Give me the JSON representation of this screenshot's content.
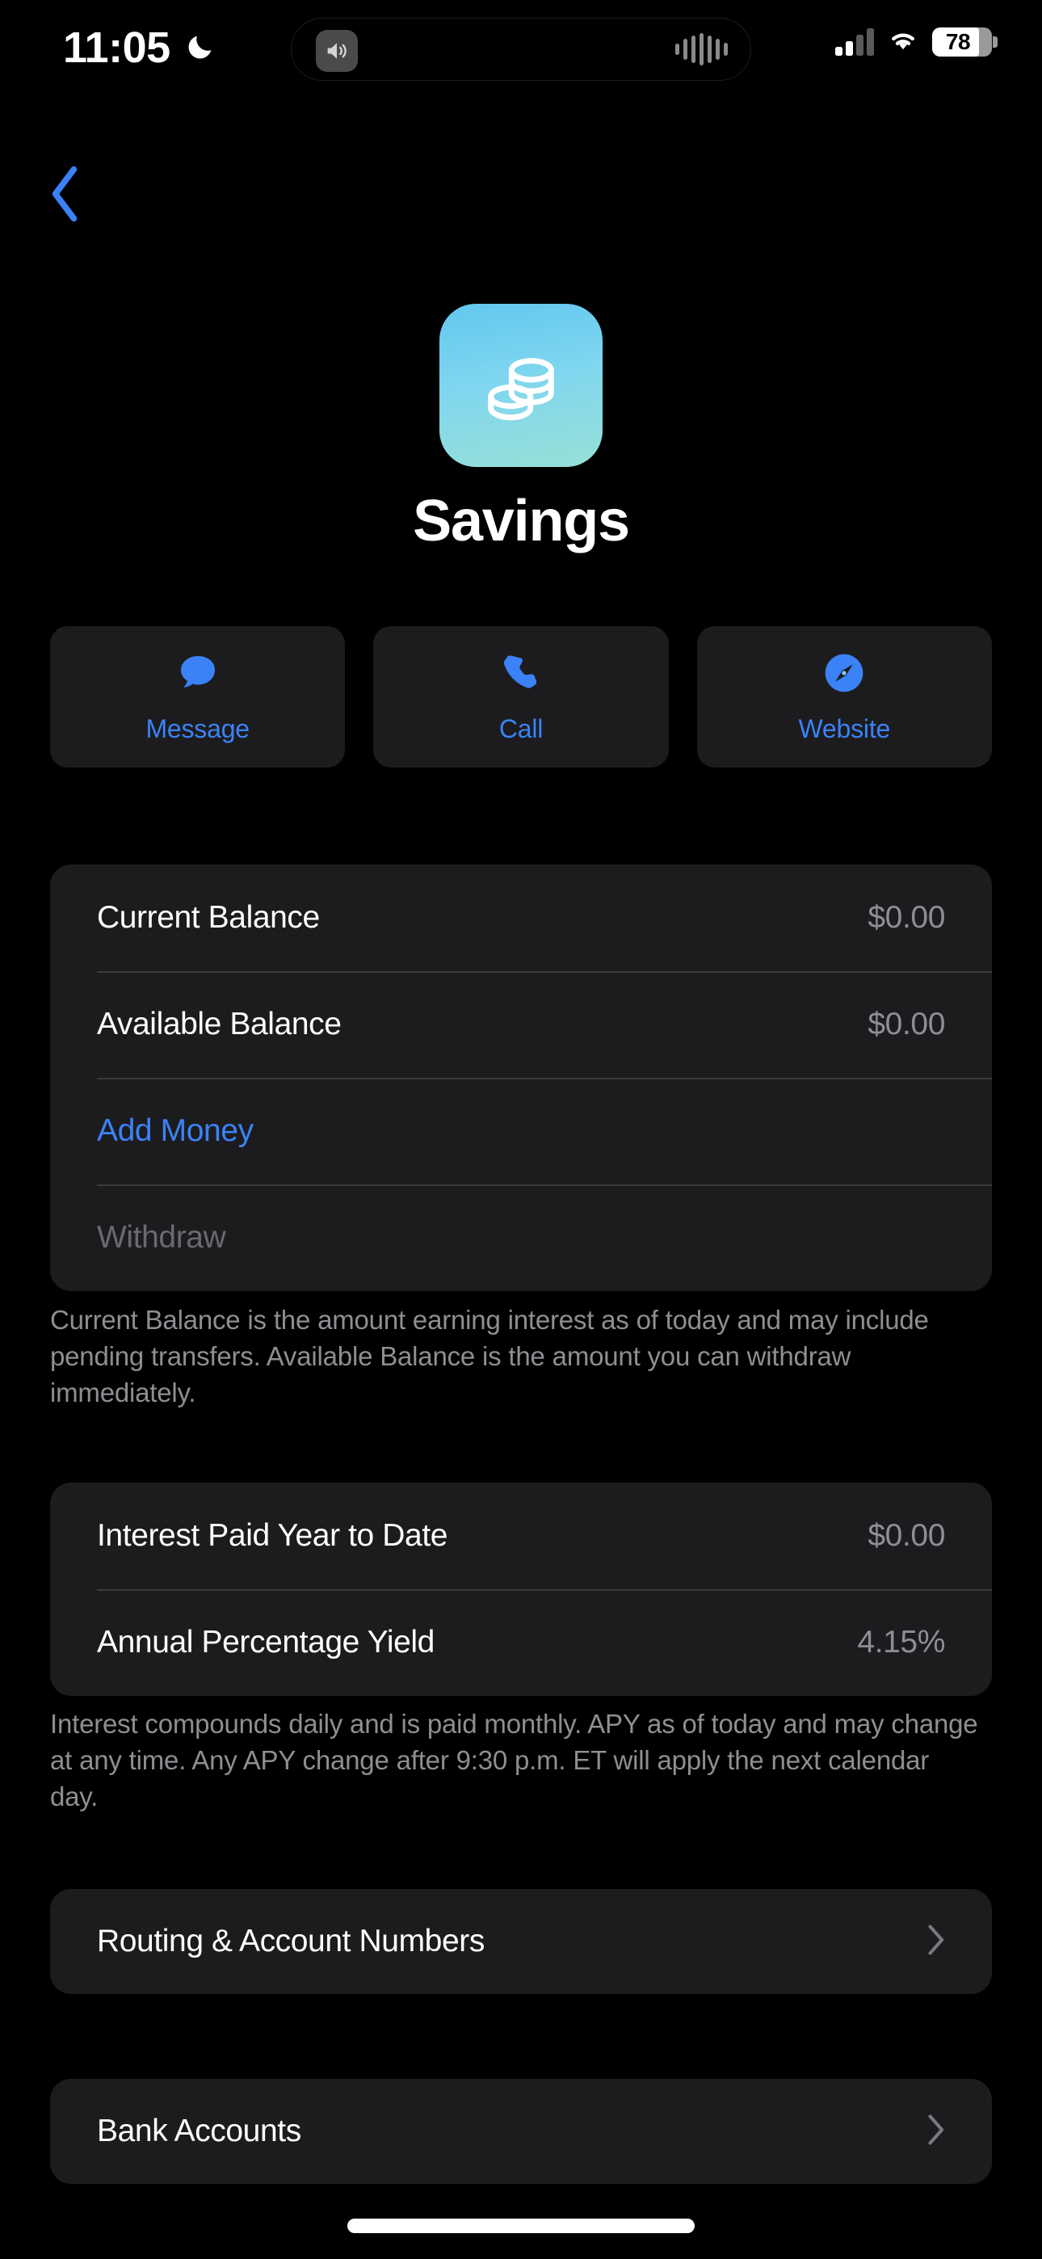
{
  "status_bar": {
    "time": "11:05",
    "dnd_icon": "crescent-moon-icon",
    "dynamic_island": {
      "speaker_icon": "speaker-wave-icon",
      "waveform_icon": "audio-waveform-icon",
      "waveform_bars": [
        14,
        26,
        34,
        40,
        34,
        26,
        16
      ]
    },
    "cellular_icon": "cellular-signal-icon",
    "cellular_bars_filled": 2,
    "cellular_bars_total": 4,
    "wifi_icon": "wifi-icon",
    "battery_icon": "battery-icon",
    "battery_percent": "78",
    "battery_level": 78
  },
  "nav": {
    "back_icon": "chevron-left-icon",
    "back_label": "Back"
  },
  "header": {
    "app_icon": "coins-stack-icon",
    "title": "Savings",
    "icon_gradient_from": "#62c7ef",
    "icon_gradient_to": "#96e0d6"
  },
  "actions": [
    {
      "label": "Message",
      "icon": "message-bubble-icon"
    },
    {
      "label": "Call",
      "icon": "phone-handset-icon"
    },
    {
      "label": "Website",
      "icon": "safari-compass-icon"
    }
  ],
  "balance_card": {
    "rows": [
      {
        "label": "Current Balance",
        "value": "$0.00",
        "style": "value"
      },
      {
        "label": "Available Balance",
        "value": "$0.00",
        "style": "value"
      },
      {
        "label": "Add Money",
        "value": "",
        "style": "link"
      },
      {
        "label": "Withdraw",
        "value": "",
        "style": "disabled"
      }
    ]
  },
  "balance_note": "Current Balance is the amount earning interest as of today and may include pending transfers. Available Balance is the amount you can withdraw immediately.",
  "interest_card": {
    "rows": [
      {
        "label": "Interest Paid Year to Date",
        "value": "$0.00",
        "style": "value"
      },
      {
        "label": "Annual Percentage Yield",
        "value": "4.15%",
        "style": "value"
      }
    ]
  },
  "interest_note": "Interest compounds daily and is paid monthly. APY as of today and may change at any time. Any APY change after 9:30 p.m. ET will apply the next calendar day.",
  "nav_rows": [
    {
      "label": "Routing & Account Numbers",
      "chevron": "chevron-right-icon"
    },
    {
      "label": "Bank Accounts",
      "chevron": "chevron-right-icon"
    }
  ],
  "colors": {
    "accent_blue": "#3b82f6",
    "card_background": "#1c1c1e",
    "secondary_text": "#8e8e93",
    "disabled_text": "#6a6a6e",
    "separator": "#3a3a3c",
    "page_background": "#000000"
  }
}
